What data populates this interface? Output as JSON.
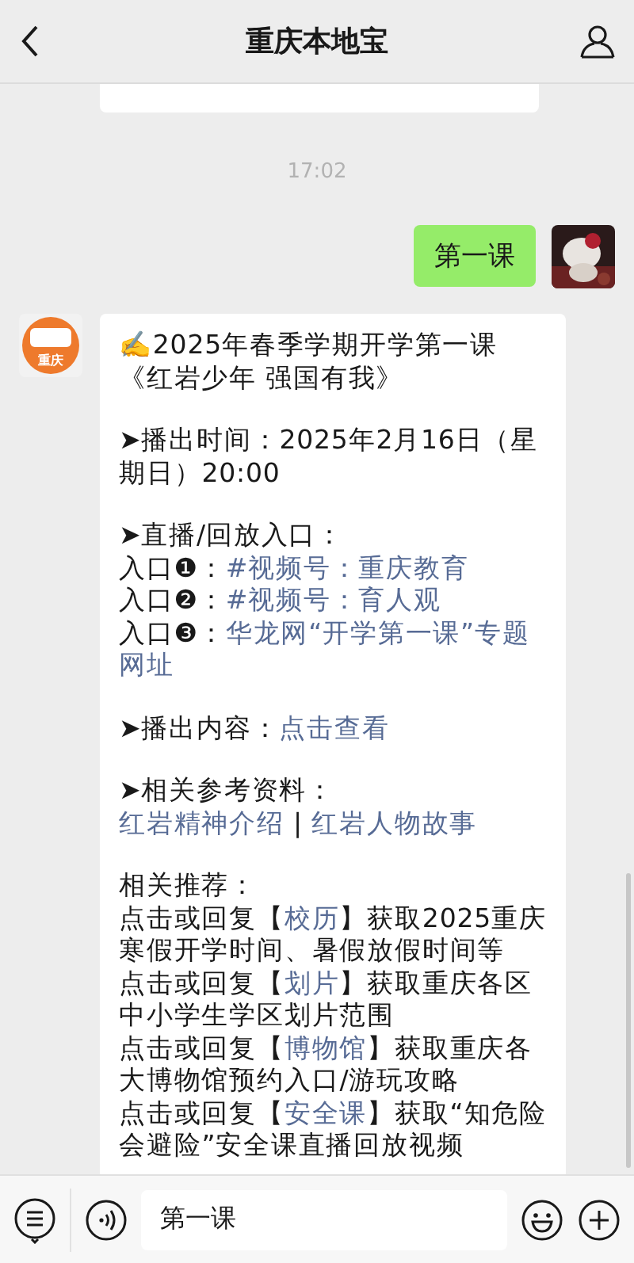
{
  "header": {
    "title": "重庆本地宝"
  },
  "time": "17:02",
  "my_message": {
    "text": "第一课"
  },
  "bot": {
    "avatar_text": "重庆",
    "paragraphs": [
      [
        [
          {
            "text": "✍️2025年春季学期开学第一课",
            "link": false
          }
        ],
        [
          {
            "text": "《红岩少年 强国有我》",
            "link": false
          }
        ]
      ],
      [
        [
          {
            "text": "➤播出时间：2025年2月16日（星",
            "link": false
          }
        ],
        [
          {
            "text": "期日）20:00",
            "link": false
          }
        ]
      ],
      [
        [
          {
            "text": "➤直播/回放入口：",
            "link": false
          }
        ],
        [
          {
            "text": "入口❶：",
            "link": false
          },
          {
            "text": "#视频号：重庆教育",
            "link": true
          }
        ],
        [
          {
            "text": "入口❷：",
            "link": false
          },
          {
            "text": "#视频号：育人观",
            "link": true
          }
        ],
        [
          {
            "text": "入口❸：",
            "link": false
          },
          {
            "text": "华龙网“开学第一课”专题",
            "link": true
          }
        ],
        [
          {
            "text": "网址",
            "link": true
          }
        ]
      ],
      [
        [
          {
            "text": "➤播出内容：",
            "link": false
          },
          {
            "text": "点击查看",
            "link": true
          }
        ]
      ],
      [
        [
          {
            "text": "➤相关参考资料：",
            "link": false
          }
        ],
        [
          {
            "text": "红岩精神介绍",
            "link": true
          },
          {
            "text": " | ",
            "link": false
          },
          {
            "text": "红岩人物故事",
            "link": true
          }
        ]
      ],
      [
        [
          {
            "text": "相关推荐：",
            "link": false
          }
        ],
        [
          {
            "text": "点击或回复【",
            "link": false
          },
          {
            "text": "校历",
            "link": true
          },
          {
            "text": "】获取2025重庆",
            "link": false
          }
        ],
        [
          {
            "text": "寒假开学时间、暑假放假时间等",
            "link": false
          }
        ],
        [
          {
            "text": "点击或回复【",
            "link": false
          },
          {
            "text": "划片",
            "link": true
          },
          {
            "text": "】获取重庆各区",
            "link": false
          }
        ],
        [
          {
            "text": "中小学生学区划片范围",
            "link": false
          }
        ],
        [
          {
            "text": "点击或回复【",
            "link": false
          },
          {
            "text": "博物馆",
            "link": true
          },
          {
            "text": "】获取重庆各",
            "link": false
          }
        ],
        [
          {
            "text": "大博物馆预约入口/游玩攻略",
            "link": false
          }
        ],
        [
          {
            "text": "点击或回复【",
            "link": false
          },
          {
            "text": "安全课",
            "link": true
          },
          {
            "text": "】获取“知危险",
            "link": false
          }
        ],
        [
          {
            "text": "会避险”安全课直播回放视频",
            "link": false
          }
        ]
      ]
    ]
  },
  "input": {
    "value": "第一课"
  }
}
